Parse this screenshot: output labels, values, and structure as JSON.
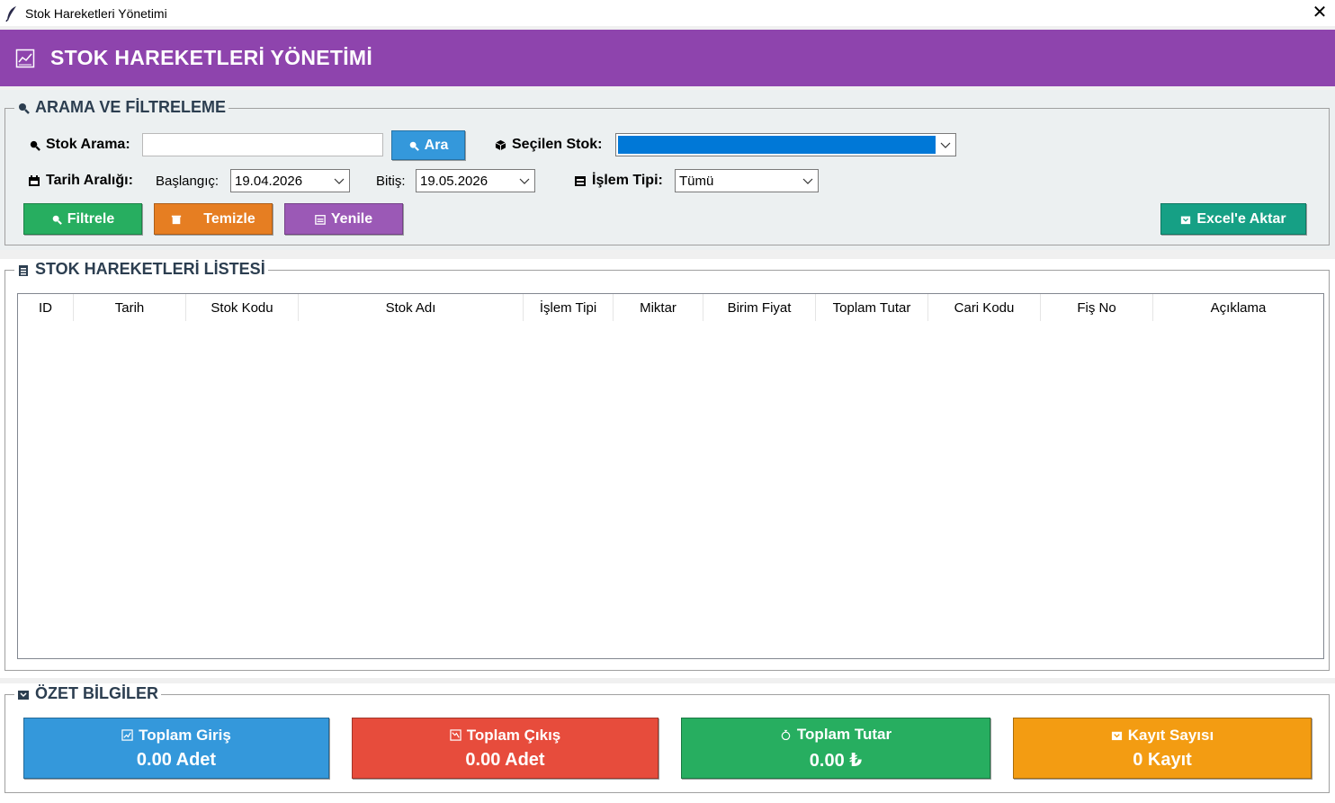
{
  "window": {
    "title": "Stok Hareketleri Yönetimi",
    "close": "✕"
  },
  "header": {
    "title": "STOK HAREKETLERİ YÖNETİMİ"
  },
  "search": {
    "legend": "ARAMA VE FİLTRELEME",
    "stock_search_label": "Stok Arama:",
    "stock_search_value": "",
    "search_button": "Ara",
    "selected_stock_label": "Seçilen Stok:",
    "selected_stock_value": "",
    "date_range_label": "Tarih Aralığı:",
    "start_label": "Başlangıç:",
    "start_value": "19.04.2026",
    "end_label": "Bitiş:",
    "end_value": "19.05.2026",
    "op_type_label": "İşlem Tipi:",
    "op_type_value": "Tümü",
    "filter_button": "Filtrele",
    "clear_button": "Temizle",
    "refresh_button": "Yenile",
    "export_button": "Excel'e Aktar"
  },
  "list": {
    "legend": "STOK HAREKETLERİ LİSTESİ",
    "columns": [
      "ID",
      "Tarih",
      "Stok Kodu",
      "Stok Adı",
      "İşlem Tipi",
      "Miktar",
      "Birim Fiyat",
      "Toplam Tutar",
      "Cari Kodu",
      "Fiş No",
      "Açıklama"
    ],
    "rows": []
  },
  "summary": {
    "legend": "ÖZET BİLGİLER",
    "cards": [
      {
        "title": "Toplam Giriş",
        "value": "0.00 Adet",
        "color": "#3498db"
      },
      {
        "title": "Toplam Çıkış",
        "value": "0.00 Adet",
        "color": "#e74c3c"
      },
      {
        "title": "Toplam Tutar",
        "value": "0.00 ₺",
        "color": "#27ae60"
      },
      {
        "title": "Kayıt Sayısı",
        "value": "0 Kayıt",
        "color": "#f39c12"
      }
    ]
  },
  "colors": {
    "header": "#8e44ad",
    "filter": "#27ae60",
    "clear": "#e67e22",
    "refresh": "#9b59b6",
    "search": "#3498db",
    "export": "#16a085"
  }
}
